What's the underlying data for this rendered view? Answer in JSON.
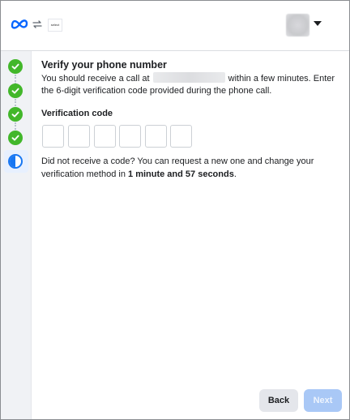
{
  "header": {
    "logo_icon": "meta-logo-icon",
    "swap_icon": "swap-arrows-icon",
    "app_tile_text": "select",
    "account_menu_icon": "caret-down-icon"
  },
  "sidebar": {
    "steps": [
      {
        "status": "complete",
        "icon": "check-circle-icon"
      },
      {
        "status": "complete",
        "icon": "check-circle-icon"
      },
      {
        "status": "complete",
        "icon": "check-circle-icon"
      },
      {
        "status": "complete",
        "icon": "check-circle-icon"
      },
      {
        "status": "current",
        "icon": "half-circle-icon"
      }
    ],
    "colors": {
      "complete": "#42b72a",
      "current": "#1877f2"
    }
  },
  "main": {
    "title": "Verify your phone number",
    "desc_part1": "You should receive a call at",
    "desc_part2": "within a few minutes. Enter the 6-digit verification code provided during the phone call.",
    "code_label": "Verification code",
    "code_digits": [
      "",
      "",
      "",
      "",
      "",
      ""
    ],
    "resend_text": "Did not receive a code? You can request a new one and change your verification method in",
    "resend_time": "1 minute and 57 seconds",
    "resend_end": "."
  },
  "footer": {
    "back_label": "Back",
    "next_label": "Next",
    "next_enabled": false
  }
}
